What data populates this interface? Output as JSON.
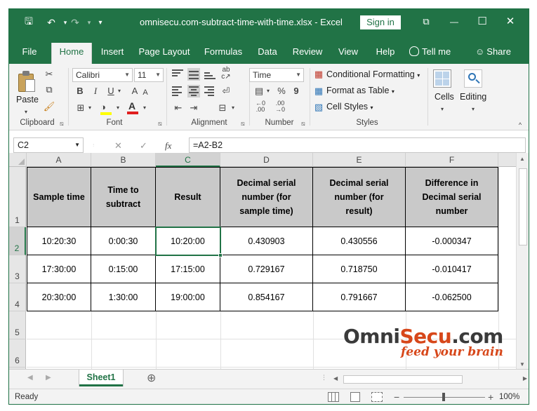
{
  "window": {
    "title": "omnisecu.com-subtract-time-with-time.xlsx  -  Excel",
    "sign_in": "Sign in",
    "controls": {
      "restore_ribbon": "⧉",
      "minimize": "—",
      "maximize": "☐",
      "close": "✕"
    }
  },
  "quick_access": {
    "save": "🖫",
    "undo": "↶",
    "redo": "↷",
    "customize": "▾"
  },
  "tabs": [
    {
      "label": "File"
    },
    {
      "label": "Home"
    },
    {
      "label": "Insert"
    },
    {
      "label": "Page Layout"
    },
    {
      "label": "Formulas"
    },
    {
      "label": "Data"
    },
    {
      "label": "Review"
    },
    {
      "label": "View"
    },
    {
      "label": "Help"
    },
    {
      "label": "Tell me"
    },
    {
      "label": "Share"
    }
  ],
  "ribbon": {
    "clipboard": {
      "label": "Clipboard",
      "paste": "Paste"
    },
    "font": {
      "label": "Font",
      "name": "Calibri",
      "size": "11",
      "bold": "B",
      "italic": "I",
      "underline": "U",
      "grow": "A",
      "shrink": "A"
    },
    "alignment": {
      "label": "Alignment"
    },
    "number": {
      "label": "Number",
      "format": "Time",
      "percent": "%",
      "comma": "9"
    },
    "styles": {
      "label": "Styles",
      "conditional": "Conditional Formatting",
      "format_table": "Format as Table",
      "cell_styles": "Cell Styles"
    },
    "cells": {
      "label": "Cells"
    },
    "editing": {
      "label": "Editing"
    }
  },
  "formula_bar": {
    "name_box": "C2",
    "cancel": "✕",
    "enter": "✓",
    "fx": "fx",
    "formula": "=A2-B2"
  },
  "columns": [
    "A",
    "B",
    "C",
    "D",
    "E",
    "F"
  ],
  "rows": [
    "1",
    "2",
    "3",
    "4",
    "5",
    "6"
  ],
  "table": {
    "headers": [
      "Sample time",
      "Time to subtract",
      "Result",
      "Decimal serial number (for sample time)",
      "Decimal serial number (for result)",
      "Difference in Decimal serial number"
    ],
    "data": [
      [
        "10:20:30",
        "0:00:30",
        "10:20:00",
        "0.430903",
        "0.430556",
        "-0.000347"
      ],
      [
        "17:30:00",
        "0:15:00",
        "17:15:00",
        "0.729167",
        "0.718750",
        "-0.010417"
      ],
      [
        "20:30:00",
        "1:30:00",
        "19:00:00",
        "0.854167",
        "0.791667",
        "-0.062500"
      ]
    ]
  },
  "logo": {
    "omni": "Omni",
    "secu": "Secu",
    "com": ".com",
    "tagline": "feed your brain"
  },
  "sheets": {
    "active": "Sheet1",
    "add": "⊕"
  },
  "status": {
    "ready": "Ready",
    "zoom": "100%",
    "zoom_minus": "−",
    "zoom_plus": "+"
  },
  "colors": {
    "excel_green": "#217346",
    "logo_red": "#d7471a",
    "logo_dark": "#3a3a3a"
  }
}
